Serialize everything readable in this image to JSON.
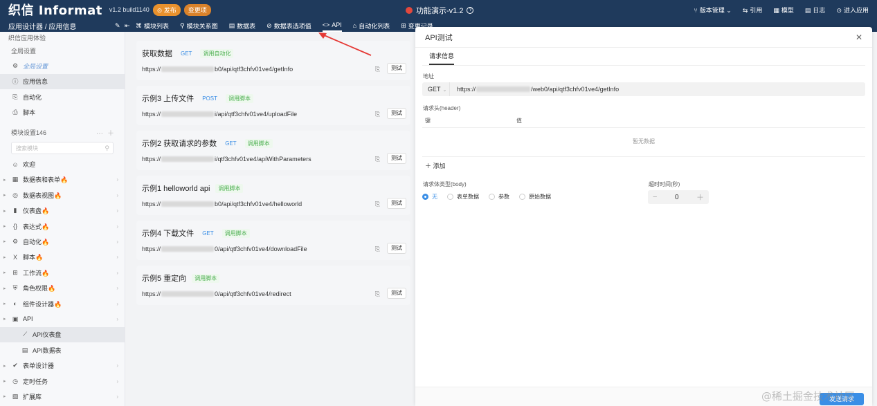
{
  "topbar": {
    "logo": "织信 Informat",
    "version": "v1.2 build1140",
    "badge_publish": "⊙ 发布",
    "badge_changes": "变更项",
    "center_title": "功能演示-v1.2",
    "right_nav": [
      {
        "icon": "branch-icon",
        "glyph": "⑂",
        "label": "版本管理 ⌄"
      },
      {
        "icon": "link-icon",
        "glyph": "⇆",
        "label": "引用"
      },
      {
        "icon": "model-icon",
        "glyph": "▦",
        "label": "模型"
      },
      {
        "icon": "log-icon",
        "glyph": "▤",
        "label": "日志"
      },
      {
        "icon": "enter-app-icon",
        "glyph": "⊙",
        "label": "进入应用"
      }
    ]
  },
  "subbar": {
    "breadcrumb": "应用设计器 / 应用信息",
    "tabs": [
      {
        "glyph": "⌘",
        "label": "模块列表"
      },
      {
        "glyph": "⚲",
        "label": "模块关系图"
      },
      {
        "glyph": "▤",
        "label": "数据表"
      },
      {
        "glyph": "⊘",
        "label": "数据表选项值"
      },
      {
        "glyph": "<>",
        "label": "API"
      },
      {
        "glyph": "⌂",
        "label": "自动化列表"
      },
      {
        "glyph": "⊞",
        "label": "变更记录"
      }
    ],
    "active_tab": "API"
  },
  "sidebar": {
    "app_name": "织信应用体验",
    "global_settings": "全局设置",
    "items_top": [
      {
        "glyph": "⚙",
        "label": "全局设置",
        "style": "italic"
      },
      {
        "glyph": "ⓘ",
        "label": "应用信息",
        "style": "active"
      },
      {
        "glyph": "⎘",
        "label": "自动化",
        "style": ""
      },
      {
        "glyph": "⎙",
        "label": "脚本",
        "style": ""
      }
    ],
    "module_header": "模块设置146",
    "search_placeholder": "搜索模块",
    "modules": [
      {
        "glyph": "☺",
        "label": "欢迎"
      },
      {
        "glyph": "▦",
        "label": "数据表和表单🔥"
      },
      {
        "glyph": "◎",
        "label": "数据表视图🔥"
      },
      {
        "glyph": "▮",
        "label": "仪表盘🔥"
      },
      {
        "glyph": "{}",
        "label": "表达式🔥"
      },
      {
        "glyph": "⚙",
        "label": "自动化🔥"
      },
      {
        "glyph": "X",
        "label": "脚本🔥"
      },
      {
        "glyph": "⊞",
        "label": "工作流🔥"
      },
      {
        "glyph": "⛨",
        "label": "角色权限🔥"
      },
      {
        "glyph": "◐",
        "label": "组件设计器🔥"
      },
      {
        "glyph": "▣",
        "label": "API"
      }
    ],
    "sub_items": [
      {
        "glyph": "⟋",
        "label": "API仪表盘"
      },
      {
        "glyph": "▤",
        "label": "API数据表"
      }
    ],
    "modules_bottom": [
      {
        "glyph": "✔",
        "label": "表单设计器"
      },
      {
        "glyph": "◷",
        "label": "定时任务"
      },
      {
        "glyph": "▧",
        "label": "扩展库"
      }
    ]
  },
  "api_list": [
    {
      "title": "获取数据",
      "method": "GET",
      "type": "调用自动化",
      "url_prefix": "https://",
      "url_suffix": "b0/api/qtf3chfv01ve4/getInfo"
    },
    {
      "title": "示例3 上传文件",
      "method": "POST",
      "type": "调用脚本",
      "url_prefix": "https://",
      "url_suffix": "i/api/qtf3chfv01ve4/uploadFile"
    },
    {
      "title": "示例2 获取请求的参数",
      "method": "GET",
      "type": "调用脚本",
      "url_prefix": "https://",
      "url_suffix": "i/qtf3chfv01ve4/apiWithParameters"
    },
    {
      "title": "示例1 helloworld api",
      "method": "",
      "type": "调用脚本",
      "url_prefix": "https://",
      "url_suffix": "b0/api/qtf3chfv01ve4/helloworld"
    },
    {
      "title": "示例4 下载文件",
      "method": "GET",
      "type": "调用脚本",
      "url_prefix": "https://",
      "url_suffix": "0/api/qtf3chfv01ve4/downloadFile"
    },
    {
      "title": "示例5 重定向",
      "method": "",
      "type": "调用脚本",
      "url_prefix": "https://",
      "url_suffix": "0/api/qtf3chfv01ve4/redirect"
    }
  ],
  "test_button": "测试",
  "panel": {
    "title": "API测试",
    "tab": "请求信息",
    "address_label": "地址",
    "method": "GET",
    "url_prefix": "https://",
    "url_suffix": "/web0/api/qtf3chfv01ve4/getInfo",
    "header_label": "请求头(header)",
    "col_key": "键",
    "col_value": "值",
    "no_data": "暂无数据",
    "add": "＋ 添加",
    "body_type_label": "请求体类型(body)",
    "body_options": [
      "无",
      "表单数据",
      "参数",
      "原始数据"
    ],
    "body_selected": "无",
    "timeout_label": "超时时间(秒)",
    "timeout_value": "0",
    "send_button": "发送请求"
  },
  "watermark": "@稀土掘金技术社区"
}
